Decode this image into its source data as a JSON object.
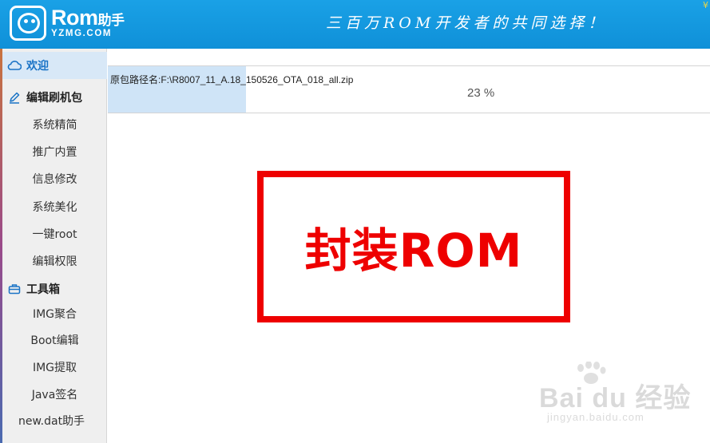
{
  "header": {
    "logo_name": "Rom",
    "logo_name_suffix": "助手",
    "logo_domain": "YZMG.COM",
    "slogan": "三百万ROM开发者的共同选择！",
    "corner_icon": "¥"
  },
  "sidebar": {
    "items": [
      {
        "label": "欢迎",
        "icon": "cloud-icon"
      },
      {
        "label": "编辑刷机包",
        "icon": "pencil-icon"
      },
      {
        "label": "系统精简"
      },
      {
        "label": "推广内置"
      },
      {
        "label": "信息修改"
      },
      {
        "label": "系统美化"
      },
      {
        "label": "一键root"
      },
      {
        "label": "编辑权限"
      },
      {
        "label": "工具箱",
        "icon": "toolbox-icon"
      },
      {
        "label": "IMG聚合"
      },
      {
        "label": "Boot编辑"
      },
      {
        "label": "IMG提取"
      },
      {
        "label": "Java签名"
      },
      {
        "label": "new.dat助手"
      }
    ]
  },
  "main": {
    "path_label": "原包路径名:F:\\R8007_11_A.18_150526_OTA_018_all.zip",
    "progress_percent": 23,
    "progress_text": "23 %",
    "annotation_text": "封装ROM"
  },
  "watermark": {
    "brand": "Bai du 经验",
    "url": "jingyan.baidu.com"
  },
  "colors": {
    "header_blue": "#1aa1e6",
    "active_bg": "#d8e8f7",
    "progress_fill": "#cfe4f7",
    "annotation_red": "#ee0000"
  }
}
